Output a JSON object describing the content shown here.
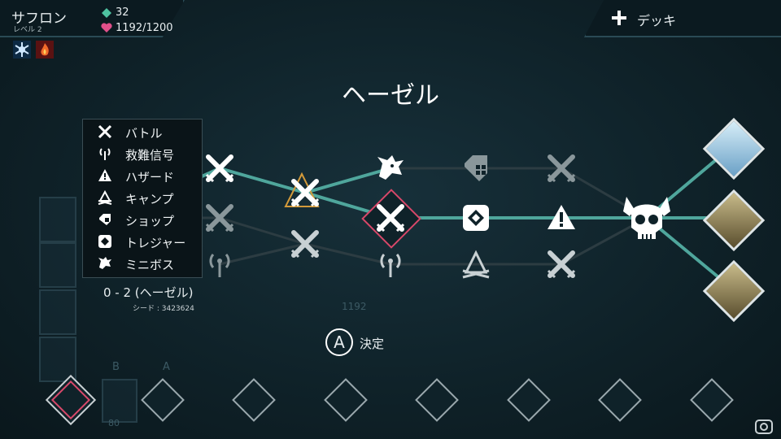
{
  "player": {
    "name": "サフロン",
    "level": "レベル 2",
    "gems": "32",
    "hp": "1192/1200"
  },
  "deck": {
    "label": "デッキ"
  },
  "area": {
    "title": "ヘーゼル",
    "stage": "0 - 2 (ヘーゼル)",
    "seed": "シード : 3423624"
  },
  "confirm": {
    "button": "A",
    "label": "決定"
  },
  "legend": [
    {
      "icon": "battle-icon",
      "label": "バトル"
    },
    {
      "icon": "distress-signal-icon",
      "label": "救難信号"
    },
    {
      "icon": "hazard-icon",
      "label": "ハザード"
    },
    {
      "icon": "camp-icon",
      "label": "キャンプ"
    },
    {
      "icon": "shop-icon",
      "label": "ショップ"
    },
    {
      "icon": "treasure-icon",
      "label": "トレジャー"
    },
    {
      "icon": "miniboss-icon",
      "label": "ミニボス"
    }
  ],
  "background_labels": {
    "hp_ghost": "1192",
    "card_ghost": "80",
    "b": "B",
    "a": "A"
  },
  "colors": {
    "path": "#4fa69c",
    "selected": "#d8486a",
    "current": "#d39a3a",
    "gem": "#4fc3a1",
    "heart": "#e0508a"
  }
}
